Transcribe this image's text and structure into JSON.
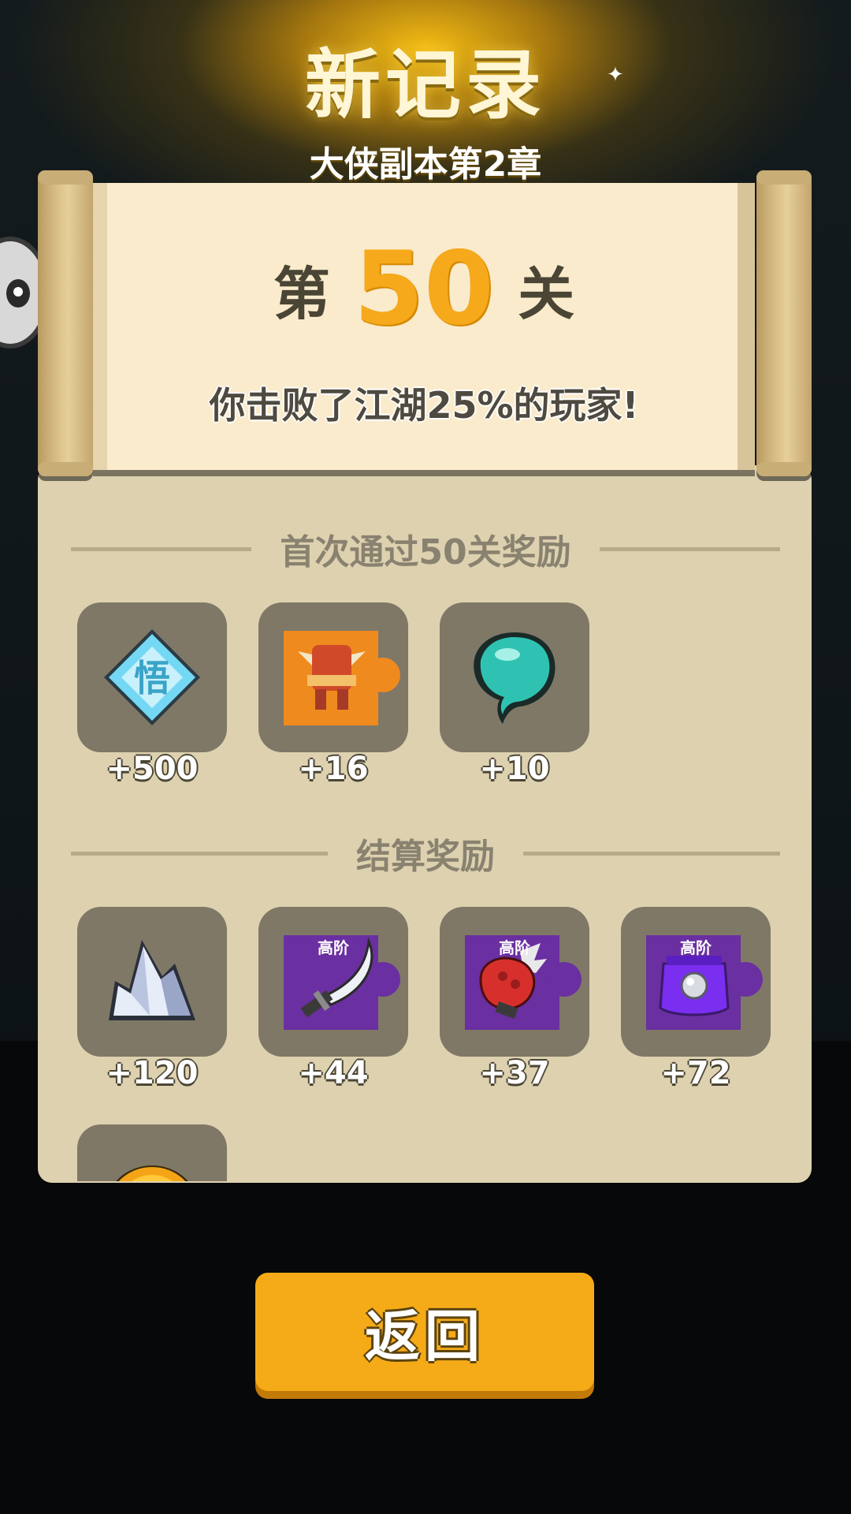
{
  "header": {
    "title": "新记录",
    "subtitle": "大侠副本第2章"
  },
  "result": {
    "level_prefix": "第",
    "level_number": "50",
    "level_suffix": "关",
    "beat_text": "你击败了江湖25%的玩家!"
  },
  "first_clear": {
    "title": "首次通过50关奖励",
    "rewards": [
      {
        "icon": "wisdom-diamond-icon",
        "amount": "+500"
      },
      {
        "icon": "orange-armor-puzzle-icon",
        "amount": "+16"
      },
      {
        "icon": "teal-jade-icon",
        "amount": "+10"
      }
    ]
  },
  "settlement": {
    "title": "结算奖励",
    "rewards": [
      {
        "icon": "crystal-icon",
        "amount": "+120"
      },
      {
        "icon": "saber-puzzle-icon",
        "tag": "高阶",
        "amount": "+44"
      },
      {
        "icon": "gauntlet-puzzle-icon",
        "tag": "高阶",
        "amount": "+37"
      },
      {
        "icon": "purple-armor-puzzle-icon",
        "tag": "高阶",
        "amount": "+72"
      }
    ],
    "partial_reward": {
      "icon": "gold-coin-icon"
    }
  },
  "actions": {
    "back_label": "返回"
  },
  "colors": {
    "accent": "#f5ab17",
    "level_number": "#f6a91a",
    "panel": "#ddd1af",
    "paper": "#faebcc",
    "tile": "#7f7867"
  }
}
